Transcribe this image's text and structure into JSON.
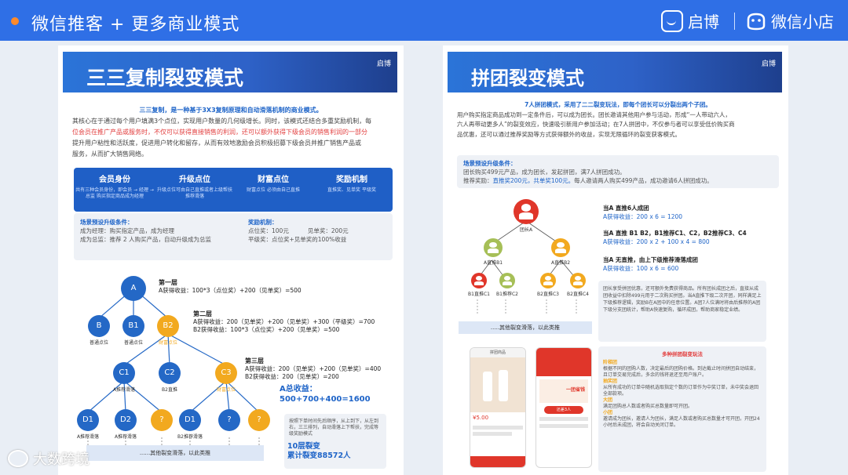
{
  "header": {
    "title": "微信推客 + 更多商业模式",
    "brand1": "启博",
    "brand2": "微信小店",
    "accent": "#2f6fe6",
    "bullet_color": "#ff8a2a"
  },
  "left": {
    "title": "三三复制裂变模式",
    "mini_logo": "启博",
    "intro_center": "三三复制，是一种基于3X3复制原理和自动滑落机制的商业模式。",
    "intro_lines": [
      "其核心在于通过每个用户填满3个点位，实现用户数量的几何级增长。同时，该模式还结合多重奖励机制，每",
      "位会员在推广产品或服务时，不仅可以获得直接销售的利润，还可以额外获得下级会员的销售利润的一部分",
      "提升用户粘性和活跃度，促进用户转化和留存，从而有效地激励会员积极招募下级会员并推广销售产品或",
      "服务，从而扩大销售网络。"
    ],
    "band": [
      {
        "h": "会员身份",
        "s": "共有三种会员身份，即会员 → 经理 → 总监 购买指定商品成为经理"
      },
      {
        "h": "升级点位",
        "s": "升级点位可由自己直推或者上级帮扶推荐滑落"
      },
      {
        "h": "财富点位",
        "s": "财富点位 必须由自己直推"
      },
      {
        "h": "奖励机制",
        "s": "直推奖、见单奖 平级奖"
      }
    ],
    "cond": {
      "title": "场景预设升级条件：",
      "l1": "成为经理：购买指定产品，成为经理",
      "l2": "成为总监：推荐 2 人购买产品，自动升级成为总监",
      "r_title": "奖励机制：",
      "r1a": "点位奖：100元",
      "r1b": "见单奖：200元",
      "r2": "平级奖：点位奖+见单奖的100%收益"
    },
    "tree": {
      "A": "A",
      "B": "B",
      "B1": "B1",
      "B2": "B2",
      "C1": "C1",
      "C2": "C2",
      "C3": "C3",
      "D1a": "D1",
      "D2": "D2",
      "Q1": "?",
      "D1b": "D1",
      "Q2": "?",
      "Q3": "?",
      "lab_b": "普通点位",
      "lab_b1": "普通点位",
      "lab_b2": "财富点位",
      "lab_c1": "A推荐滑落",
      "lab_c2": "B2直推",
      "lab_c3": "财富点位",
      "lab_d1": "A推荐滑落",
      "lab_d2": "A推荐滑落",
      "lab_d1b": "B2推荐滑落"
    },
    "layers": {
      "l1_title": "第一层",
      "l1_text": "A获得收益：100*3（点位奖）+200（见单奖）=500",
      "l2_title": "第二层",
      "l2_a": "A获得收益：200（见单奖）+200（见单奖）+300（平级奖）=700",
      "l2_b": "B2获得收益：100*3（点位奖）+200（见单奖）=500",
      "l3_title": "第三层",
      "l3_a": "A获得收益：200（见单奖）+200（见单奖）=400",
      "l3_b": "B2获得收益：200（见单奖）=200"
    },
    "total_title": "A总收益：",
    "total_value": "500+700+400=1600",
    "note": "按照下单时间先后顺序，从上到下，从左到右，三三排列，自动滑落上下帮扶，完成等级奖励模式",
    "layer_result1": "10层裂变",
    "layer_result2": "累计裂变88572人",
    "footband": "......其他裂变滑落，以此类推"
  },
  "right": {
    "title": "拼团裂变模式",
    "mini_logo": "启博",
    "intro_center": "7人拼团模式，采用了二二裂变玩法，即每个团长可以分裂出两个子团。",
    "intro_lines": [
      "用户购买指定商品成功到一定条件后，可以成为团长。团长邀请其他用户参与活动，形成“一人带动六人，",
      "六人再带动更多人”的裂变效应，快速吸引新用户参加活动；在7人拼团中，不仅参与者可以享受低价购买商",
      "品优惠，还可以通过推荐奖励等方式获得额外的收益，实现无限循环的裂变获客模式。"
    ],
    "scene_title": "场景预设升级条件：",
    "scene_l1": "团长购买499元产品，成为团长，发起拼团，满7人拼团成功。",
    "scene_l2a": "推荐奖励：",
    "scene_l2b": "直推奖200元，共单奖100元。",
    "scene_l2c": "每人邀请两人购买499产品，成功邀请6人拼团成功。",
    "nodes": {
      "top": "团长A",
      "b1": "A直推B1",
      "b2": "A直推B2",
      "c1": "B1直推C1",
      "c2": "B1推荐C2",
      "c3": "B2直推C3",
      "c4": "B2直推C4"
    },
    "rules": {
      "r1": "当A 直推6人成团",
      "r1b": "A获得收益：200 x 6 = 1200",
      "r2": "当A 直推 B1 B2，B1推荐C1、C2，B2推荐C3、C4",
      "r2b": "A获得收益：200 x 2 + 100 x 4 = 800",
      "r3": "当A 无直推，由上下级推荐滑落成团",
      "r3b": "A获得收益：100 x 6 = 600"
    },
    "ex_text": "团长享受拼团优惠，还可额外免费获得商品。所有团长成团之后，直接从成团收益中扣除499元用于二次购买拼团。当A直推下级二次开团，同样满足上下级推荐逻辑，奖励B在A团中的任意位置。A团7人位满时将由后推荐的A团下级分支团统计，帮助A快速复购，循环成团，帮助商家稳定业绩。",
    "more": ".....其他裂变滑落，以此类推",
    "play": {
      "title": "多种拼团裂变玩法",
      "s1": "阶梯团",
      "t1": "根据不同的团购人数，决定最后的团购价格。到达截止时间拼团自动结束，且订单交易完成后，多余的钱将退还至用户账户。",
      "s2": "抽奖团",
      "t2": "从所有成功的订单中随机选取指定个数的订单作为中奖订单，未中奖会退回全部款项。",
      "s3": "大团",
      "t3": "满足团购总人数或者购买总数量即可开团。",
      "s4": "小团",
      "t4": "邀请成为团长，邀请人为团长，满足人数或者购买总数量才可开团，开团24小时后未成团，将会自动关闭订单。"
    },
    "phone1": {
      "label": "拼团商品",
      "price": "¥5.00"
    },
    "phone2": {
      "label": "一团省钱",
      "btn": "还差3人"
    }
  },
  "watermark": "大数跨境"
}
